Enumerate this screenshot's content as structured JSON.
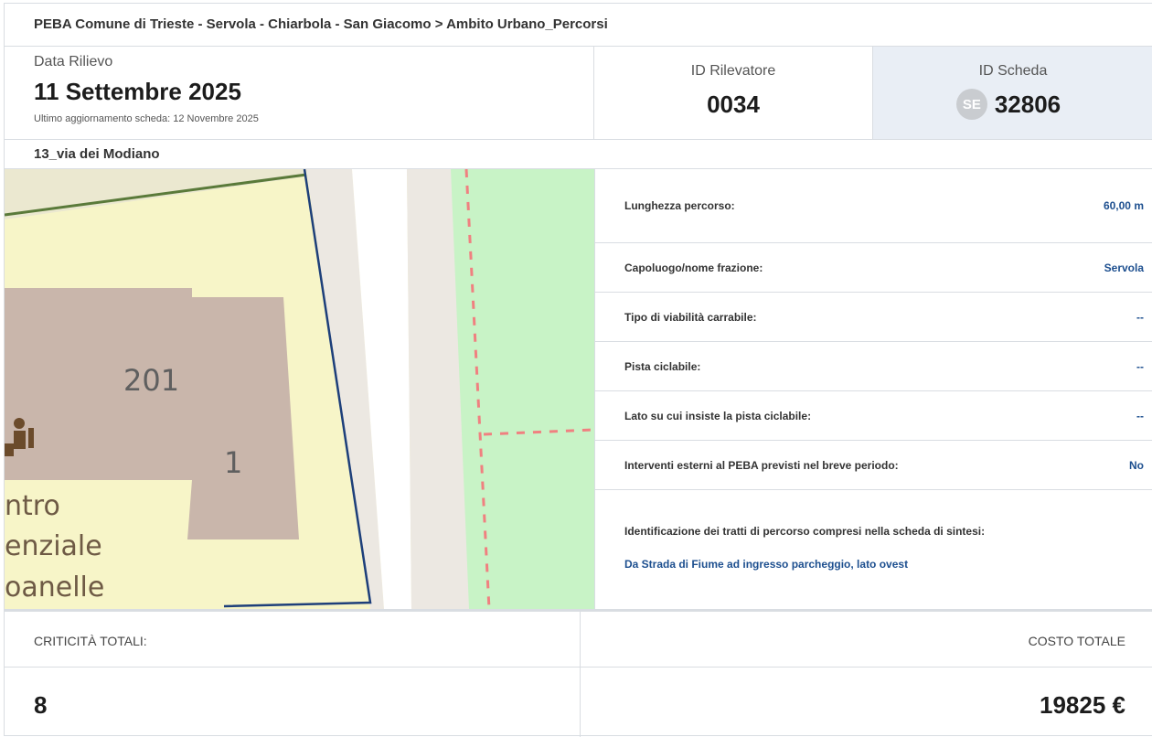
{
  "breadcrumb": "PEBA Comune di Trieste - Servola - Chiarbola - San Giacomo > Ambito Urbano_Percorsi",
  "survey": {
    "date_label": "Data Rilievo",
    "date_value": "11 Settembre 2025",
    "updated": "Ultimo aggiornamento scheda: 12 Novembre 2025"
  },
  "surveyor": {
    "label": "ID Rilevatore",
    "value": "0034"
  },
  "sheet": {
    "label": "ID Scheda",
    "badge": "SE",
    "value": "32806"
  },
  "section_title": "13_via dei Modiano",
  "map": {
    "labels": {
      "building_number": "201",
      "house_number": "1",
      "place_line1": "ntro",
      "place_line2": "enziale",
      "place_line3": "oanelle"
    },
    "colors": {
      "residential": "#f7f5c8",
      "building": "#c9b6ab",
      "road": "#ffffff",
      "sidewalk": "#ece8e2",
      "park": "#c8f3c6",
      "route": "#1d3f7a",
      "path": "#f08080"
    },
    "icon": "toilet-icon"
  },
  "details": [
    {
      "key": "Lunghezza percorso:",
      "value": "60,00 m"
    },
    {
      "key": "Capoluogo/nome frazione:",
      "value": "Servola"
    },
    {
      "key": "Tipo di viabilità carrabile:",
      "value": "--"
    },
    {
      "key": "Pista ciclabile:",
      "value": "--"
    },
    {
      "key": "Lato su cui insiste la pista ciclabile:",
      "value": "--"
    },
    {
      "key": "Interventi esterni al PEBA previsti nel breve periodo:",
      "value": "No"
    }
  ],
  "identification": {
    "label": "Identificazione dei tratti di percorso compresi nella scheda di sintesi:",
    "value": "Da Strada di Fiume ad ingresso parcheggio, lato ovest"
  },
  "totals": {
    "criticita_label": "CRITICITÀ TOTALI:",
    "criticita_value": "8",
    "costo_label": "COSTO TOTALE",
    "costo_value": "19825 €"
  }
}
